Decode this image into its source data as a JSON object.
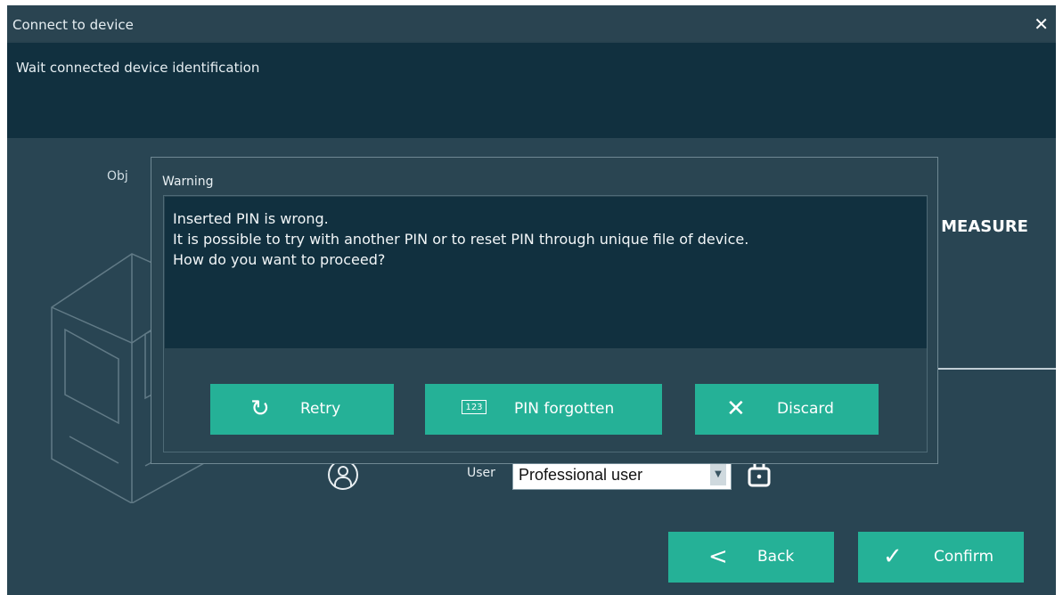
{
  "window": {
    "title": "Connect to device",
    "close_glyph": "✕"
  },
  "status": {
    "message": "Wait connected device  identification"
  },
  "background": {
    "obj_label": "Obj",
    "measure_label": ". MEASURE",
    "user_label": "User",
    "user_select_value": "Professional user",
    "back_label": "Back",
    "confirm_label": "Confirm"
  },
  "dialog": {
    "title": "Warning",
    "message_lines": [
      "Inserted PIN is wrong.",
      "It is possible to try with another PIN or to reset PIN through unique file of device.",
      "How do you want to proceed?"
    ],
    "retry_label": "Retry",
    "pin_forgotten_label": "PIN forgotten",
    "pin_icon_text": "123",
    "discard_label": "Discard"
  },
  "icons": [
    "close-icon",
    "user-icon",
    "lock-icon",
    "chevron-left-icon",
    "check-icon",
    "retry-icon",
    "keypad-icon",
    "x-icon",
    "dropdown-arrow-icon"
  ],
  "colors": {
    "accent": "#25b197",
    "panel": "#28424f",
    "dark_panel": "#11303f"
  }
}
